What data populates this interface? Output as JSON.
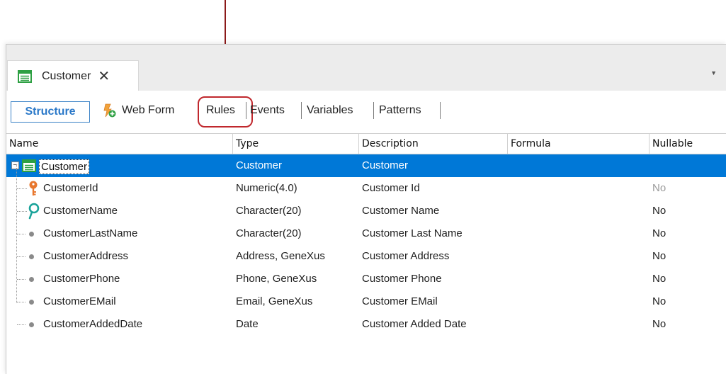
{
  "window": {
    "tab_title": "Customer",
    "tab_close": "✕",
    "menu_glyph": "▼"
  },
  "toolbar": {
    "tabs": [
      "Structure",
      "Web Form",
      "Rules",
      "Events",
      "Variables",
      "Patterns"
    ],
    "active_tab": "Structure",
    "highlighted_tab": "Rules"
  },
  "grid": {
    "columns": [
      "Name",
      "Type",
      "Description",
      "Formula",
      "Nullable"
    ],
    "root": {
      "name": "Customer",
      "type": "Customer",
      "description": "Customer"
    },
    "rows": [
      {
        "name": "CustomerId",
        "type": "Numeric(4.0)",
        "description": "Customer Id",
        "formula": "",
        "nullable": "No",
        "icon": "key-icon"
      },
      {
        "name": "CustomerName",
        "type": "Character(20)",
        "description": "Customer Name",
        "formula": "",
        "nullable": "No",
        "icon": "search-key-icon"
      },
      {
        "name": "CustomerLastName",
        "type": "Character(20)",
        "description": "Customer Last Name",
        "formula": "",
        "nullable": "No",
        "icon": "dot-icon"
      },
      {
        "name": "CustomerAddress",
        "type": "Address, GeneXus",
        "description": "Customer Address",
        "formula": "",
        "nullable": "No",
        "icon": "dot-icon"
      },
      {
        "name": "CustomerPhone",
        "type": "Phone, GeneXus",
        "description": "Customer Phone",
        "formula": "",
        "nullable": "No",
        "icon": "dot-icon"
      },
      {
        "name": "CustomerEMail",
        "type": "Email, GeneXus",
        "description": "Customer EMail",
        "formula": "",
        "nullable": "No",
        "icon": "dot-icon"
      },
      {
        "name": "CustomerAddedDate",
        "type": "Date",
        "description": "Customer Added Date",
        "formula": "",
        "nullable": "No",
        "icon": "dot-icon"
      }
    ]
  },
  "colors": {
    "selection": "#0078d7",
    "highlight_box": "#c0282d",
    "arrow": "#8b1a1a",
    "key_icon": "#e8772e",
    "search_key_icon": "#1aa39a",
    "table_icon": "#2ea043"
  }
}
